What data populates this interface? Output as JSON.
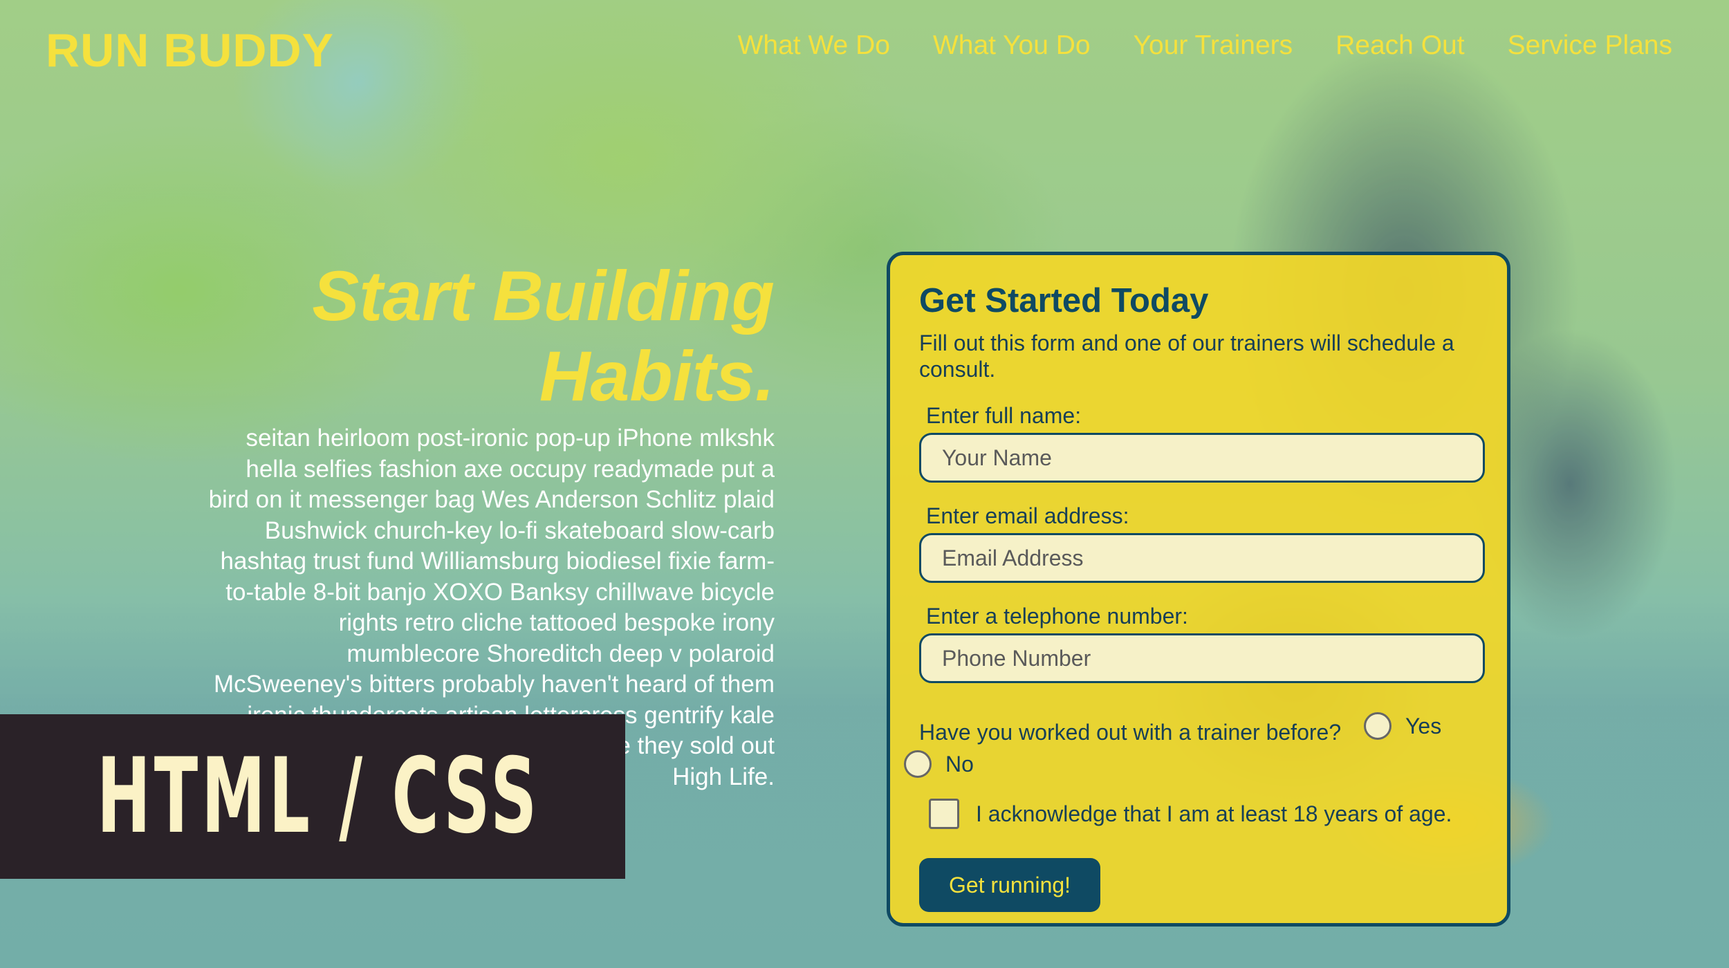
{
  "brand": {
    "name": "RUN BUDDY"
  },
  "nav": {
    "items": [
      "What We Do",
      "What You Do",
      "Your Trainers",
      "Reach Out",
      "Service Plans"
    ]
  },
  "hero": {
    "title_line1": "Start Building",
    "title_line2": "Habits.",
    "body": "seitan heirloom post-ironic pop-up iPhone mlkshk hella selfies fashion axe occupy readymade put a bird on it messenger bag Wes Anderson Schlitz plaid Bushwick church-key lo-fi skateboard slow-carb hashtag trust fund Williamsburg biodiesel fixie farm-to-table 8-bit banjo XOXO Banksy chillwave bicycle rights retro cliche tattooed bespoke irony mumblecore Shoreditch deep v polaroid McSweeney's bitters probably haven't heard of them ironic thundercats artisan letterpress gentrify kale chips lomo YOLO authentic before they sold out High Life."
  },
  "form": {
    "title": "Get Started Today",
    "subtitle": "Fill out this form and one of our trainers will schedule a consult.",
    "name_label": "Enter full name:",
    "name_placeholder": "Your Name",
    "email_label": "Enter email address:",
    "email_placeholder": "Email Address",
    "phone_label": "Enter a telephone number:",
    "phone_placeholder": "Phone Number",
    "trainer_question": "Have you worked out with a trainer before?",
    "option_yes": "Yes",
    "option_no": "No",
    "age_ack": "I acknowledge that I am at least 18 years of age.",
    "submit_label": "Get running!"
  },
  "overlay": {
    "label": "HTML / CSS"
  },
  "colors": {
    "brand_yellow": "#f5e13d",
    "navy": "#0f4a63",
    "banner_bg": "#2a2228"
  }
}
